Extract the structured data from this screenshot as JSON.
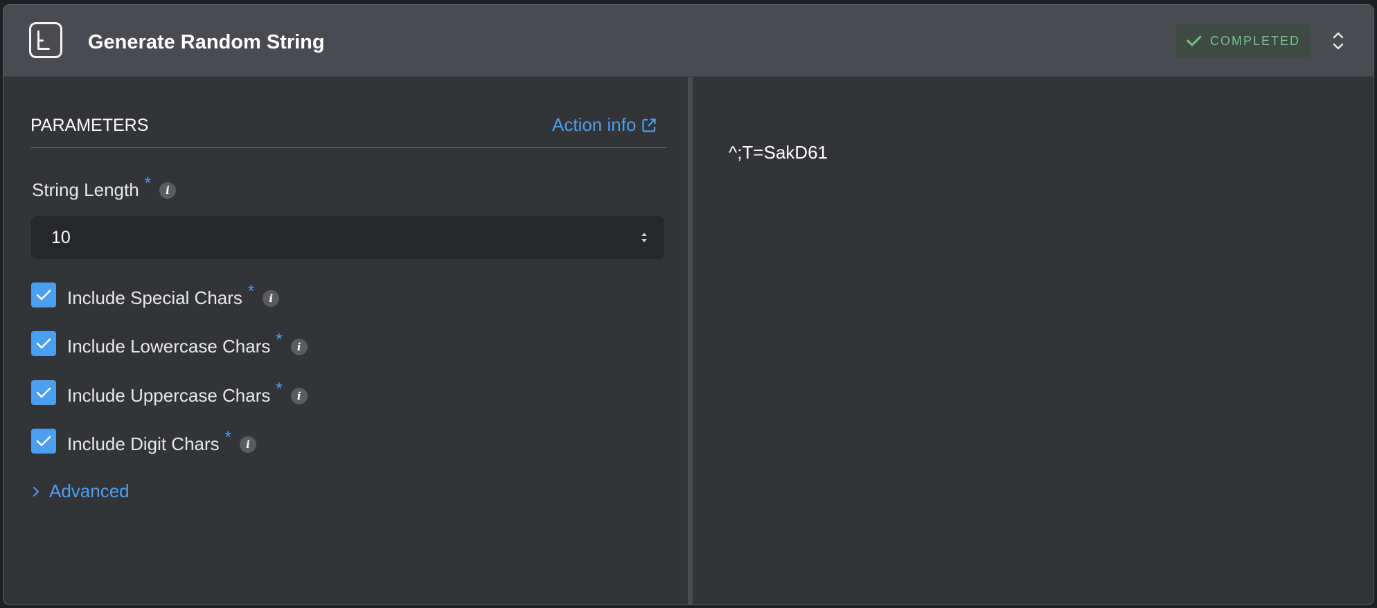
{
  "header": {
    "title": "Generate Random String",
    "status": "COMPLETED",
    "status_color": "#79c18f",
    "app_icon": "document-lines-icon"
  },
  "parameters": {
    "section_title": "PARAMETERS",
    "action_info_label": "Action info",
    "string_length": {
      "label": "String Length",
      "required_marker": "*",
      "value": "10"
    },
    "checkboxes": [
      {
        "label": "Include Special Chars",
        "required_marker": "*",
        "checked": true
      },
      {
        "label": "Include Lowercase Chars",
        "required_marker": "*",
        "checked": true
      },
      {
        "label": "Include Uppercase Chars",
        "required_marker": "*",
        "checked": true
      },
      {
        "label": "Include Digit Chars",
        "required_marker": "*",
        "checked": true
      }
    ],
    "advanced_label": "Advanced"
  },
  "output": {
    "value": "^;T=SakD61"
  },
  "colors": {
    "accent": "#4a9ff0",
    "header_bg": "#4a4b50",
    "panel_bg": "#333438"
  }
}
